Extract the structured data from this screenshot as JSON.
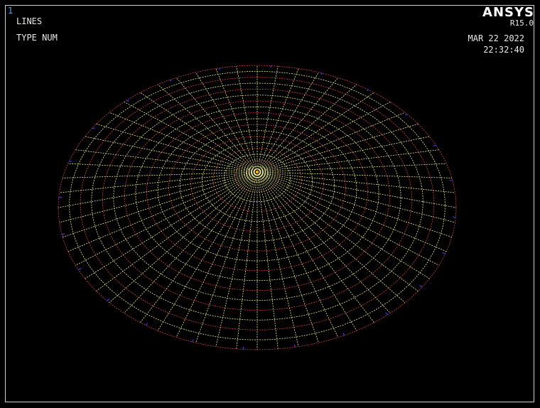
{
  "window_number": "1",
  "plot_labels": [
    "LINES",
    "TYPE NUM"
  ],
  "brand": "ANSYS",
  "version": "R15.0",
  "date": "MAR 22 2022",
  "time": "22:32:40",
  "colors": {
    "background": "#000000",
    "frame": "#d0d0d0",
    "window_number": "#4fa3e6",
    "text": "#e8e8e8",
    "mesh_lines_yellow": "#e6e68a",
    "mesh_lines_red": "#d23a4a",
    "mesh_lines_blue": "#3a3aff",
    "center_keypoint": "#ffb000"
  }
}
